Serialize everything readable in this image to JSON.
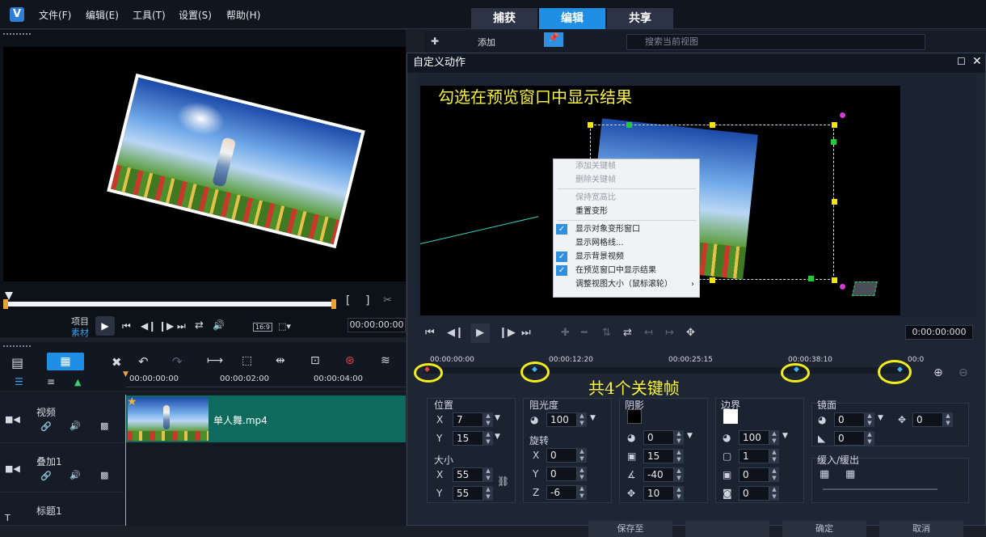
{
  "menubar": {
    "items": [
      "文件(F)",
      "编辑(E)",
      "工具(T)",
      "设置(S)",
      "帮助(H)"
    ]
  },
  "modes": {
    "capture": "捕获",
    "edit": "编辑",
    "share": "共享"
  },
  "library": {
    "add": "添加",
    "search_placeholder": "搜索当前视图"
  },
  "player": {
    "project": "项目",
    "clip": "素材",
    "timecode": "00:00:00:00",
    "aspect": "16:9"
  },
  "timeline": {
    "ruler": [
      "00:00:00:00",
      "00:00:02:00",
      "00:00:04:00"
    ]
  },
  "tracks": [
    {
      "name": "视频",
      "clip": "单人舞.mp4"
    },
    {
      "name": "叠加1"
    },
    {
      "name": "标题1"
    }
  ],
  "dialog": {
    "title": "自定义动作",
    "annotation_top": "勾选在预览窗口中显示结果",
    "annotation_keyframes": "共4个关键帧",
    "timecode": "0:00:00:000",
    "ruler": [
      "00:00:00:00",
      "00:00:12:20",
      "00:00:25:15",
      "00:00:38:10",
      "00:0"
    ],
    "context_menu": [
      {
        "label": "添加关键帧",
        "disabled": true
      },
      {
        "label": "删除关键帧",
        "disabled": true
      },
      {
        "label": "保持宽高比",
        "disabled": true
      },
      {
        "label": "重置变形"
      },
      {
        "label": "显示对象变形窗口",
        "checked": true
      },
      {
        "label": "显示网格线..."
      },
      {
        "label": "显示背景视频",
        "checked": true
      },
      {
        "label": "在预览窗口中显示结果",
        "checked": true
      },
      {
        "label": "调整视图大小（鼠标滚轮）",
        "submenu": true
      }
    ],
    "position": {
      "title": "位置",
      "x": "7",
      "y": "15"
    },
    "size": {
      "title": "大小",
      "x": "55",
      "y": "55"
    },
    "opacity": {
      "title": "阻光度",
      "value": "100"
    },
    "rotation": {
      "title": "旋转",
      "x": "0",
      "y": "0",
      "z": "-6"
    },
    "shadow": {
      "title": "阴影",
      "opacity": "0",
      "blur": "15",
      "angle": "-40",
      "distance": "10"
    },
    "border": {
      "title": "边界",
      "opacity": "100",
      "width": "1",
      "blur": "0",
      "value4": "0"
    },
    "mirror": {
      "title": "镜面",
      "opacity": "0",
      "distance": "0",
      "fade": "0"
    },
    "fade": {
      "title": "缓入/缓出"
    },
    "bottom_buttons": [
      "保存至",
      "",
      "确定",
      "取消"
    ]
  },
  "colors": {
    "accent": "#2f8fe0",
    "annotation": "#f7f23a",
    "clip": "#0e6a5d"
  }
}
